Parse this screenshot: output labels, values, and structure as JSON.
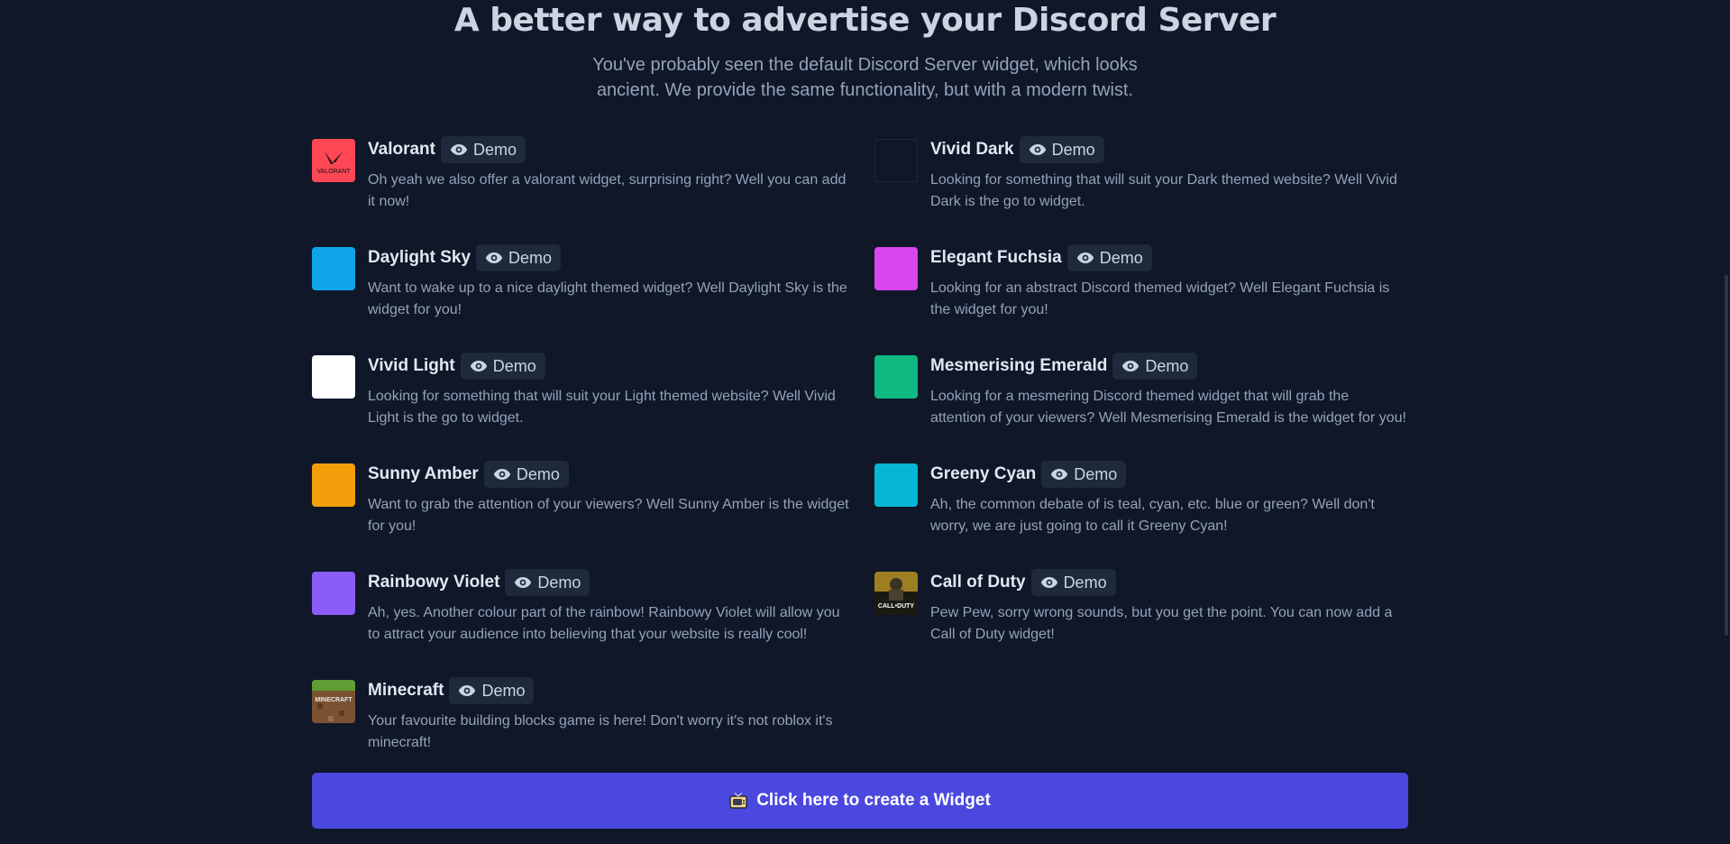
{
  "hero": {
    "title": "A better way to advertise your Discord Server",
    "subtitle_line1": "You've probably seen the default Discord Server widget, which looks",
    "subtitle_line2": "ancient. We provide the same functionality, but with a modern twist."
  },
  "demo_label": "Demo",
  "widgets": [
    {
      "title": "Valorant",
      "desc": "Oh yeah we also offer a valorant widget, surprising right? Well you can add it now!",
      "color": "#ff4655",
      "icon": "valorant-logo-icon"
    },
    {
      "title": "Vivid Dark",
      "desc": "Looking for something that will suit your Dark themed website? Well Vivid Dark is the go to widget.",
      "color": "#0f1729",
      "icon": "dark-swatch-icon"
    },
    {
      "title": "Daylight Sky",
      "desc": "Want to wake up to a nice daylight themed widget? Well Daylight Sky is the widget for you!",
      "color": "#0ea5e9",
      "icon": "sky-swatch-icon"
    },
    {
      "title": "Elegant Fuchsia",
      "desc": "Looking for an abstract Discord themed widget? Well Elegant Fuchsia is the widget for you!",
      "color": "#d946ef",
      "icon": "fuchsia-swatch-icon"
    },
    {
      "title": "Vivid Light",
      "desc": "Looking for something that will suit your Light themed website? Well Vivid Light is the go to widget.",
      "color": "#ffffff",
      "icon": "light-swatch-icon"
    },
    {
      "title": "Mesmerising Emerald",
      "desc": "Looking for a mesmering Discord themed widget that will grab the attention of your viewers? Well Mesmerising Emerald is the widget for you!",
      "color": "#10b981",
      "icon": "emerald-swatch-icon"
    },
    {
      "title": "Sunny Amber",
      "desc": "Want to grab the attention of your viewers? Well Sunny Amber is the widget for you!",
      "color": "#f59e0b",
      "icon": "amber-swatch-icon"
    },
    {
      "title": "Greeny Cyan",
      "desc": "Ah, the common debate of is teal, cyan, etc. blue or green? Well don't worry, we are just going to call it Greeny Cyan!",
      "color": "#06b6d4",
      "icon": "cyan-swatch-icon"
    },
    {
      "title": "Rainbowy Violet",
      "desc": "Ah, yes. Another colour part of the rainbow! Rainbowy Violet will allow you to attract your audience into believing that your website is really cool!",
      "color": "#8b5cf6",
      "icon": "violet-swatch-icon"
    },
    {
      "title": "Call of Duty",
      "desc": "Pew Pew, sorry wrong sounds, but you get the point. You can now add a Call of Duty widget!",
      "color": "#1a1a14",
      "icon": "call-of-duty-logo-icon"
    },
    {
      "title": "Minecraft",
      "desc": "Your favourite building blocks game is here! Don't worry it's not roblox it's minecraft!",
      "color": "#7a5232",
      "icon": "minecraft-logo-icon"
    }
  ],
  "logo_text": {
    "valorant": "VALORANT",
    "call_of_duty": "CALL•DUTY",
    "minecraft": "MINECRAFT"
  },
  "cta": {
    "label": "Click here to create a Widget",
    "icon": "tv-icon"
  }
}
